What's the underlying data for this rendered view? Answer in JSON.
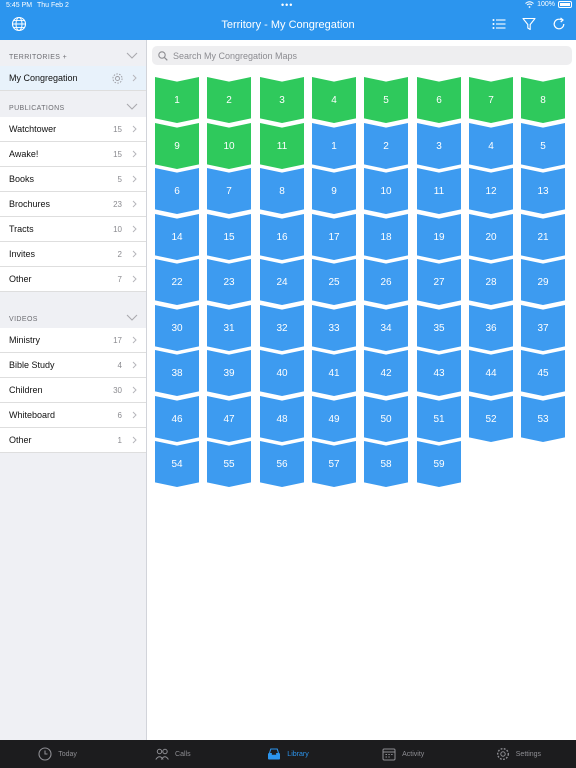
{
  "status_bar": {
    "time": "5:45 PM",
    "date": "Thu Feb 2",
    "battery": "100%"
  },
  "nav": {
    "title": "Territory - My Congregation"
  },
  "sidebar": {
    "territories": {
      "header": "TERRITORIES +",
      "items": [
        {
          "label": "My Congregation"
        }
      ]
    },
    "publications": {
      "header": "PUBLICATIONS",
      "items": [
        {
          "label": "Watchtower",
          "count": "15"
        },
        {
          "label": "Awake!",
          "count": "15"
        },
        {
          "label": "Books",
          "count": "5"
        },
        {
          "label": "Brochures",
          "count": "23"
        },
        {
          "label": "Tracts",
          "count": "10"
        },
        {
          "label": "Invites",
          "count": "2"
        },
        {
          "label": "Other",
          "count": "7"
        }
      ]
    },
    "videos": {
      "header": "VIDEOS",
      "items": [
        {
          "label": "Ministry",
          "count": "17"
        },
        {
          "label": "Bible Study",
          "count": "4"
        },
        {
          "label": "Children",
          "count": "30"
        },
        {
          "label": "Whiteboard",
          "count": "6"
        },
        {
          "label": "Other",
          "count": "1"
        }
      ]
    }
  },
  "search": {
    "placeholder": "Search My Congregation Maps"
  },
  "maps": {
    "colors": {
      "green": "#2fc95c",
      "blue": "#3d9bf0"
    },
    "green_labels": [
      "1",
      "2",
      "3",
      "4",
      "5",
      "6",
      "7",
      "8",
      "9",
      "10",
      "11"
    ],
    "blue_labels": [
      "1",
      "2",
      "3",
      "4",
      "5",
      "6",
      "7",
      "8",
      "9",
      "10",
      "11",
      "12",
      "13",
      "14",
      "15",
      "16",
      "17",
      "18",
      "19",
      "20",
      "21",
      "22",
      "23",
      "24",
      "25",
      "26",
      "27",
      "28",
      "29",
      "30",
      "31",
      "32",
      "33",
      "34",
      "35",
      "36",
      "37",
      "38",
      "39",
      "40",
      "41",
      "42",
      "43",
      "44",
      "45",
      "46",
      "47",
      "48",
      "49",
      "50",
      "51",
      "52",
      "53",
      "54",
      "55",
      "56",
      "57",
      "58",
      "59"
    ]
  },
  "tabbar": {
    "items": [
      {
        "label": "Today",
        "icon": "clock-icon"
      },
      {
        "label": "Calls",
        "icon": "people-icon"
      },
      {
        "label": "Library",
        "icon": "tray-icon",
        "active": true
      },
      {
        "label": "Activity",
        "icon": "calendar-icon"
      },
      {
        "label": "Settings",
        "icon": "gear-icon"
      }
    ]
  }
}
